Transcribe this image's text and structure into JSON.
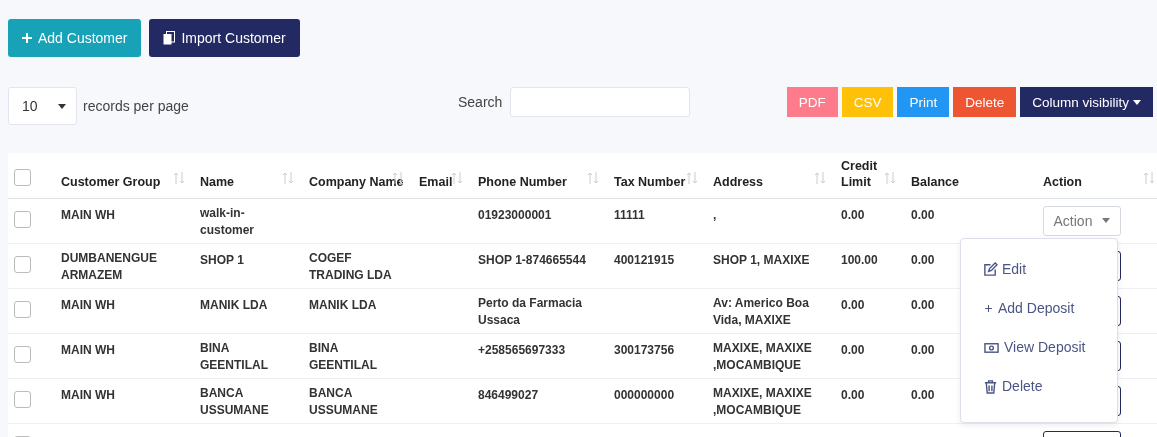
{
  "top_buttons": [
    {
      "label": "Add Customer",
      "kind": "add"
    },
    {
      "label": "Import Customer",
      "kind": "import"
    }
  ],
  "page_size": {
    "value": "10",
    "label": "records per page"
  },
  "search": {
    "label": "Search"
  },
  "export_buttons": [
    {
      "label": "PDF",
      "color": "#fd7b8a",
      "kind": "plain"
    },
    {
      "label": "CSV",
      "color": "#ffc107",
      "kind": "plain"
    },
    {
      "label": "Print",
      "color": "#2196f3",
      "kind": "plain"
    },
    {
      "label": "Delete",
      "color": "#ee5533",
      "kind": "plain"
    },
    {
      "label": "Column visibility",
      "color": "#232a63",
      "kind": "dropdown"
    }
  ],
  "table": {
    "columns": [
      {
        "label": "Customer Group",
        "sortable": true
      },
      {
        "label": "Name",
        "sortable": true
      },
      {
        "label": "Company Name",
        "sortable": true
      },
      {
        "label": "Email",
        "sortable": true
      },
      {
        "label": "Phone Number",
        "sortable": true
      },
      {
        "label": "Tax Number",
        "sortable": true
      },
      {
        "label": "Address",
        "sortable": true
      },
      {
        "label": "Credit Limit",
        "sortable": true
      },
      {
        "label": "Balance",
        "sortable": false
      },
      {
        "label": "Action",
        "sortable": true
      }
    ],
    "select_all": {
      "checked": false
    },
    "rows": [
      {
        "checked": false,
        "cells": [
          "MAIN WH",
          "walk-in-customer",
          "",
          "",
          "01923000001",
          "11111",
          ",",
          "0.00",
          "0.00"
        ],
        "action": "Action"
      },
      {
        "checked": false,
        "cells": [
          "DUMBANENGUE ARMAZEM",
          "SHOP 1",
          "COGEF TRADING LDA",
          "",
          "SHOP 1-874665544",
          "400121915",
          "SHOP 1, MAXIXE",
          "100.00",
          "0.00"
        ]
      },
      {
        "checked": false,
        "cells": [
          "MAIN WH",
          "MANIK LDA",
          "MANIK LDA",
          "",
          "Perto da Farmacia Ussaca",
          "",
          "Av: Americo Boa Vida, MAXIXE",
          "0.00",
          "0.00"
        ]
      },
      {
        "checked": false,
        "cells": [
          "MAIN WH",
          "BINA GEENTILAL",
          "BINA GEENTILAL",
          "",
          "+258565697333",
          "300173756",
          "MAXIXE, MAXIXE ,MOCAMBIQUE",
          "0.00",
          "0.00"
        ]
      },
      {
        "checked": false,
        "cells": [
          "MAIN WH",
          "BANCA USSUMANE",
          "BANCA USSUMANE",
          "",
          "846499027",
          "000000000",
          "MAXIXE, MAXIXE ,MOCAMBIQUE",
          "0.00",
          "0.00"
        ]
      },
      {
        "checked": false,
        "cells": []
      }
    ]
  },
  "action_menu": [
    {
      "label": "Edit",
      "kind": "edit"
    },
    {
      "label": "Add Deposit",
      "kind": "add"
    },
    {
      "label": "View Deposit",
      "kind": "view"
    },
    {
      "label": "Delete",
      "kind": "delete"
    }
  ]
}
